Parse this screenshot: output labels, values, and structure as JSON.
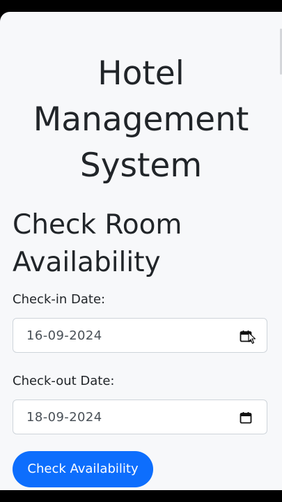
{
  "app": {
    "title": "Hotel Management System"
  },
  "availability_form": {
    "heading": "Check Room Availability",
    "checkin": {
      "label": "Check-in Date:",
      "value": "16-09-2024",
      "icon": "calendar-icon"
    },
    "checkout": {
      "label": "Check-out Date:",
      "value": "18-09-2024",
      "icon": "calendar-icon"
    },
    "submit_label": "Check Availability"
  },
  "colors": {
    "page_background": "#f7f8fa",
    "text": "#212529",
    "primary_button": "#0d6efd",
    "input_border": "#ced4da"
  }
}
